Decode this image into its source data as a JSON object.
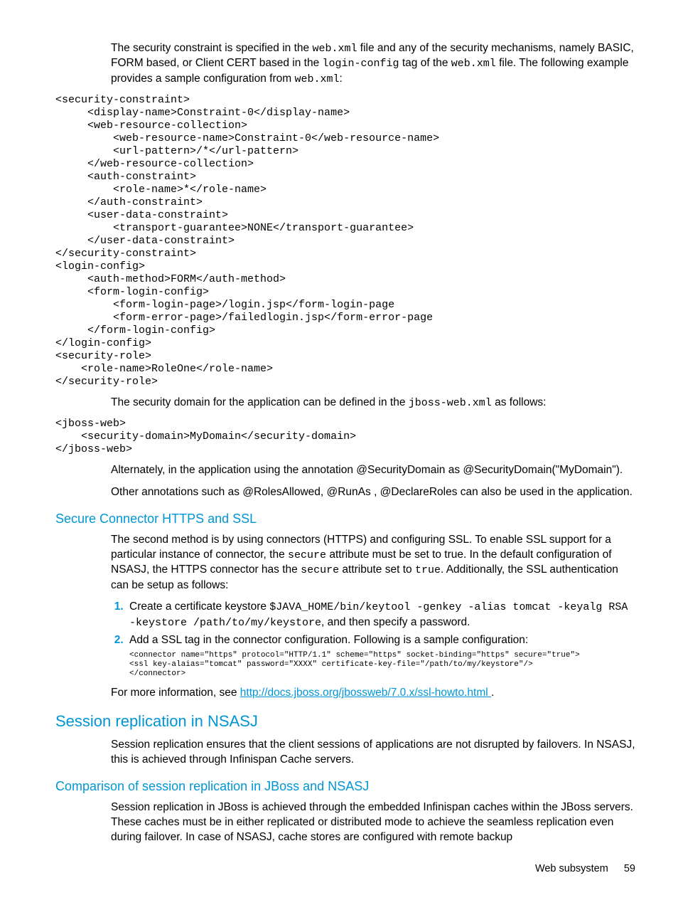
{
  "intro_para": "The security constraint is specified in the web.xml file and any of the security mechanisms, namely BASIC, FORM based, or Client CERT based in the login-config tag of the web.xml file. The following example provides a sample configuration from web.xml:",
  "intro_seg1": "The security constraint is specified in the ",
  "intro_code1": "web.xml",
  "intro_seg2": " file and any of the security mechanisms, namely BASIC, FORM based, or Client CERT based in the ",
  "intro_code2": "login-config",
  "intro_seg3": " tag of the ",
  "intro_code3": "web.xml",
  "intro_seg4": " file. The following example provides a sample configuration from ",
  "intro_code4": "web.xml",
  "intro_seg5": ":",
  "code_block_1": "<security-constraint>\n     <display-name>Constraint-0</display-name>\n     <web-resource-collection>\n         <web-resource-name>Constraint-0</web-resource-name>\n         <url-pattern>/*</url-pattern>\n     </web-resource-collection>\n     <auth-constraint>\n         <role-name>*</role-name>\n     </auth-constraint>\n     <user-data-constraint>\n         <transport-guarantee>NONE</transport-guarantee>\n     </user-data-constraint>\n</security-constraint>\n<login-config>\n     <auth-method>FORM</auth-method>\n     <form-login-config>\n         <form-login-page>/login.jsp</form-login-page\n         <form-error-page>/failedlogin.jsp</form-error-page\n     </form-login-config>\n</login-config>\n<security-role>\n    <role-name>RoleOne</role-name>\n</security-role>",
  "p2_seg1": "The security domain for the application can be defined in the ",
  "p2_code1": "jboss-web.xml",
  "p2_seg2": " as follows:",
  "code_block_2": "<jboss-web>\n    <security-domain>MyDomain</security-domain>\n</jboss-web>",
  "p3": "Alternately, in the application using the annotation @SecurityDomain as @SecurityDomain(\"MyDomain\").",
  "p4": "Other annotations such as @RolesAllowed, @RunAs , @DeclareRoles can also be used in the application.",
  "h3_1": "Secure Connector HTTPS and SSL",
  "p5_seg1": "The second method is by using connectors (HTTPS) and configuring SSL. To enable SSL support for a particular instance of connector, the ",
  "p5_code1": "secure",
  "p5_seg2": " attribute must be set to true. In the default configuration of NSASJ, the HTTPS connector has the ",
  "p5_code2": "secure",
  "p5_seg3": " attribute set to ",
  "p5_code3": "true",
  "p5_seg4": ". Additionally, the SSL authentication can be setup as follows:",
  "step1_seg1": "Create a certificate keystore ",
  "step1_code1": "$JAVA_HOME/bin/keytool -genkey -alias tomcat -keyalg RSA -keystore /path/to/my/keystore",
  "step1_seg2": ", and then specify a password.",
  "step2": "Add a SSL tag in the connector configuration. Following is a sample configuration:",
  "code_block_3": "<connector name=\"https\" protocol=\"HTTP/1.1\" scheme=\"https\" socket-binding=\"https\" secure=\"true\">\n<ssl key-alaias=\"tomcat\" password=\"XXXX\" certificate-key-file=\"/path/to/my/keystore\"/>\n</connector>",
  "p6_seg1": "For more information, see ",
  "link1_text": "http://docs.jboss.org/jbossweb/7.0.x/ssl-howto.html ",
  "p6_seg2": ".",
  "h2_1": "Session replication in NSASJ",
  "p7": "Session replication ensures that the client sessions of applications are not disrupted by failovers. In NSASJ, this is achieved through Infinispan Cache servers.",
  "h3_2": "Comparison of session replication in JBoss and NSASJ",
  "p8": "Session replication in JBoss is achieved through the embedded Infinispan caches within the JBoss servers. These caches must be in either replicated or distributed mode to achieve the seamless replication even during failover. In case of NSASJ, cache stores are configured with remote backup",
  "footer_label": "Web subsystem",
  "footer_page": "59"
}
